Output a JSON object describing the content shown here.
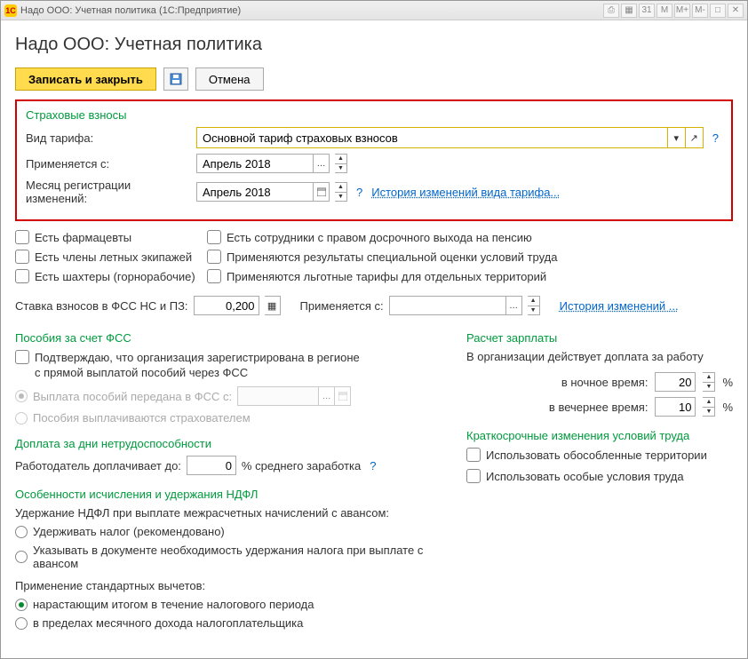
{
  "titlebar": {
    "app_icon": "1C",
    "title": "Надо ООО: Учетная политика  (1С:Предприятие)"
  },
  "page_title": "Надо ООО: Учетная политика",
  "toolbar": {
    "save_and_close": "Записать и закрыть",
    "cancel": "Отмена"
  },
  "insurance": {
    "title": "Страховые взносы",
    "tariff_label": "Вид тарифа:",
    "tariff_value": "Основной тариф страховых взносов",
    "applies_from_label": "Применяется с:",
    "applies_from_value": "Апрель 2018",
    "reg_month_label": "Месяц регистрации изменений:",
    "reg_month_value": "Апрель 2018",
    "history_link": "История изменений вида тарифа..."
  },
  "checkboxes": {
    "pharmacists": "Есть фармацевты",
    "early_retire": "Есть сотрудники с правом досрочного выхода на пенсию",
    "flight_crews": "Есть члены летных экипажей",
    "special_eval": "Применяются результаты специальной оценки условий труда",
    "miners": "Есть шахтеры (горнорабочие)",
    "pref_tariffs": "Применяются льготные тарифы для отдельных территорий"
  },
  "fss_rate": {
    "label": "Ставка взносов в ФСС НС и ПЗ:",
    "value": "0,200",
    "applies_label": "Применяется с:",
    "applies_value": "",
    "history_link": "История изменений ..."
  },
  "fss_benefits": {
    "title": "Пособия за счет ФСС",
    "confirm": "Подтверждаю, что организация зарегистрирована в регионе",
    "confirm2": "с прямой выплатой пособий через ФСС",
    "transfer": "Выплата пособий передана в ФСС с:",
    "insurer_pays": "Пособия выплачиваются страхователем"
  },
  "disability_pay": {
    "title": "Доплата за дни нетрудоспособности",
    "employer_label": "Работодатель доплачивает до:",
    "value": "0",
    "percent_label": "% среднего заработка"
  },
  "ndfl": {
    "title": "Особенности исчисления и удержания НДФЛ",
    "heading": "Удержание НДФЛ при выплате межрасчетных начислений с авансом:",
    "opt_hold": "Удерживать налог (рекомендовано)",
    "opt_indicate": "Указывать в документе необходимость удержания налога при выплате с авансом",
    "deductions_heading": "Применение стандартных вычетов:",
    "opt_cumulative": "нарастающим итогом в течение налогового периода",
    "opt_monthly": "в пределах месячного дохода налогоплательщика"
  },
  "salary": {
    "title": "Расчет зарплаты",
    "intro": "В организации действует доплата за работу",
    "night_label": "в ночное время:",
    "night_value": "20",
    "evening_label": "в вечернее время:",
    "evening_value": "10",
    "percent": "%"
  },
  "short_term": {
    "title": "Краткосрочные изменения условий труда",
    "territories": "Использовать обособленные территории",
    "special_conditions": "Использовать особые условия труда"
  }
}
